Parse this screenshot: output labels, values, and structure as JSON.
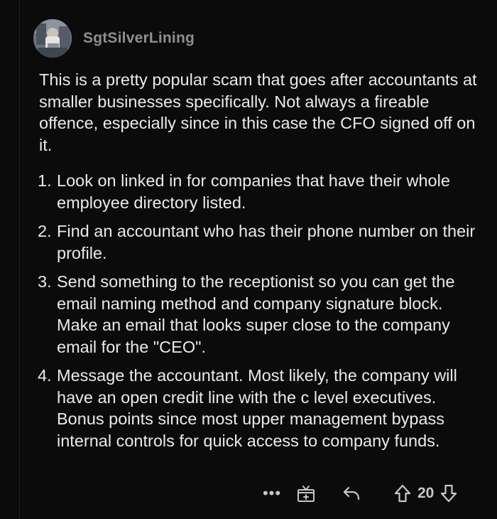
{
  "comment": {
    "username": "SgtSilverLining",
    "paragraph": "This is a pretty popular scam that goes after accountants at smaller businesses specifically. Not always a fireable offence, especially since in this case the CFO signed off on it.",
    "list": [
      {
        "num": "1.",
        "text": "Look on linked in for companies that have their whole employee directory listed."
      },
      {
        "num": "2.",
        "text": "Find an accountant who has their phone number on their profile."
      },
      {
        "num": "3.",
        "text": "Send something to the receptionist so you can get the email naming method and company signature block. Make an email that looks super close to the company email for the \"CEO\"."
      },
      {
        "num": "4.",
        "text": "Message the accountant. Most likely, the company will have an open credit line with the c level executives. Bonus points since most upper management bypass internal controls for quick access to company funds."
      }
    ]
  },
  "actions": {
    "more_label": "•••",
    "score": "20",
    "icons": {
      "more": "more-icon",
      "award": "award-icon",
      "reply": "reply-icon",
      "upvote": "upvote-icon",
      "downvote": "downvote-icon"
    }
  },
  "colors": {
    "background": "#0b0b0c",
    "text": "#eaeaeb",
    "username": "#8e8e93",
    "icon": "#c7c7cc"
  }
}
